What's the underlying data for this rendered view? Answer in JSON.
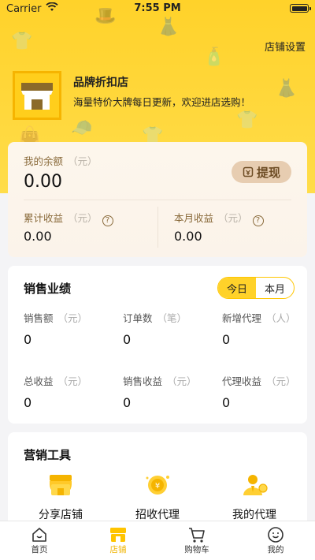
{
  "status_bar": {
    "carrier": "Carrier",
    "time": "7:55 PM"
  },
  "header": {
    "settings_label": "店铺设置",
    "shop_name": "品牌折扣店",
    "shop_desc": "海量特价大牌每日更新，欢迎进店选购！"
  },
  "balance": {
    "label": "我的余额",
    "unit": "（元）",
    "value": "0.00",
    "withdraw_label": "提现",
    "cumulative_label": "累计收益",
    "cumulative_unit": "（元）",
    "cumulative_value": "0.00",
    "monthly_label": "本月收益",
    "monthly_unit": "（元）",
    "monthly_value": "0.00"
  },
  "performance": {
    "title": "销售业绩",
    "toggle": {
      "today": "今日",
      "month": "本月",
      "selected": "today"
    },
    "stats": [
      {
        "label": "销售额",
        "unit": "（元）",
        "value": "0"
      },
      {
        "label": "订单数",
        "unit": "（笔）",
        "value": "0"
      },
      {
        "label": "新增代理",
        "unit": "（人）",
        "value": "0"
      },
      {
        "label": "总收益",
        "unit": "（元）",
        "value": "0"
      },
      {
        "label": "销售收益",
        "unit": "（元）",
        "value": "0"
      },
      {
        "label": "代理收益",
        "unit": "（元）",
        "value": "0"
      }
    ]
  },
  "tools": {
    "title": "营销工具",
    "items": [
      {
        "label": "分享店铺",
        "icon": "share-shop-icon"
      },
      {
        "label": "招收代理",
        "icon": "recruit-agent-icon"
      },
      {
        "label": "我的代理",
        "icon": "my-agent-icon"
      }
    ]
  },
  "tabbar": {
    "items": [
      {
        "label": "首页",
        "icon": "home-icon",
        "active": false
      },
      {
        "label": "店铺",
        "icon": "store-icon",
        "active": true
      },
      {
        "label": "购物车",
        "icon": "cart-icon",
        "active": false
      },
      {
        "label": "我的",
        "icon": "profile-icon",
        "active": false
      }
    ]
  },
  "colors": {
    "accent": "#ffd22a",
    "tab_active": "#f0b400",
    "withdraw_bg": "#e7cdb1"
  }
}
